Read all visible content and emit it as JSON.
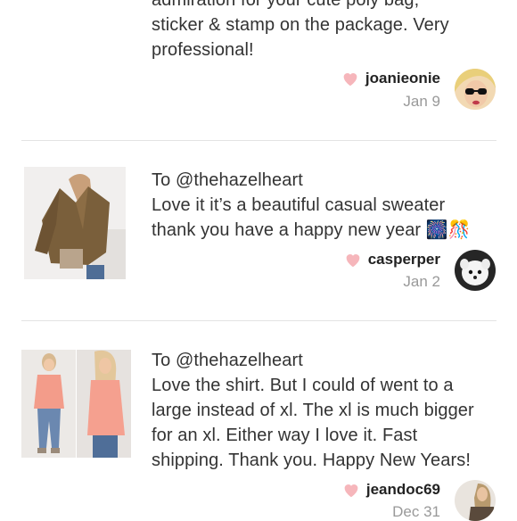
{
  "accent_color": "#f6b6bb",
  "reviews": [
    {
      "lines": [
        "admiration for your cute poly bag,",
        "sticker & stamp on the package. Very",
        "professional!"
      ],
      "username": "joanieonie",
      "date": "Jan 9",
      "avatar_icon": "sunglasses-avatar"
    },
    {
      "to": "To @thehazelheart",
      "lines": [
        "Love it it’s a beautiful casual sweater",
        "thank you have a happy new year"
      ],
      "emojis": [
        "🎆",
        "🎊"
      ],
      "username": "casperper",
      "date": "Jan 2",
      "avatar_icon": "white-dog-avatar"
    },
    {
      "to": "To @thehazelheart",
      "lines": [
        "Love the shirt. But I could of went to a",
        "large instead of xl. The xl is much bigger",
        "for an xl. Either way I love it. Fast",
        "shipping. Thank you. Happy New Years!"
      ],
      "username": "jeandoc69",
      "date": "Dec 31",
      "avatar_icon": "person-avatar"
    }
  ]
}
